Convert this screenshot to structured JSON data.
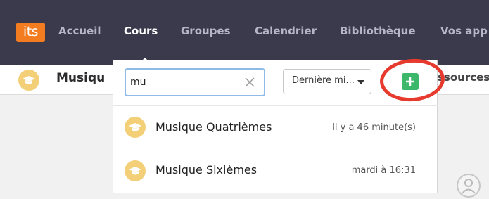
{
  "navbar": {
    "logo": "its",
    "items": [
      {
        "label": "Accueil",
        "active": false
      },
      {
        "label": "Cours",
        "active": true
      },
      {
        "label": "Groupes",
        "active": false
      },
      {
        "label": "Calendrier",
        "active": false
      },
      {
        "label": "Bibliothèque",
        "active": false
      },
      {
        "label": "Vos app",
        "active": false
      }
    ]
  },
  "subheader": {
    "title": "Musiqu",
    "right_text": "ssources"
  },
  "search": {
    "value": "mu",
    "clear_icon": "close-icon"
  },
  "sort": {
    "selected": "Dernière mi..."
  },
  "add_button": {
    "icon": "plus-icon"
  },
  "results": [
    {
      "title": "Musique Quatrièmes",
      "time": "Il y a 46 minute(s)",
      "icon": "graduation-cap-icon"
    },
    {
      "title": "Musique Sixièmes",
      "time": "mardi à 16:31",
      "icon": "graduation-cap-icon"
    }
  ],
  "colors": {
    "navbar": "#3b3a4c",
    "logo": "#f47c20",
    "course_icon": "#f3cf78",
    "add_button": "#3db86b",
    "highlight": "#e63a2e"
  }
}
